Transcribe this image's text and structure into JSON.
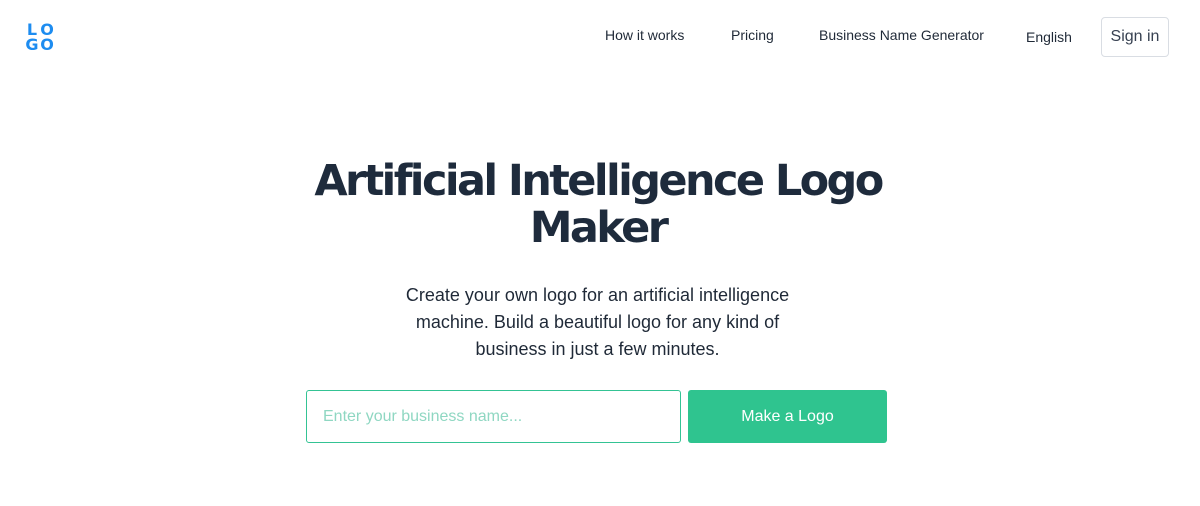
{
  "brand": {
    "logo_letters": [
      "L",
      "O",
      "G",
      "O"
    ],
    "color": "#1d8cf0"
  },
  "nav": {
    "how_it_works": "How it works",
    "pricing": "Pricing",
    "business_name_generator": "Business Name Generator",
    "language": "English",
    "sign_in": "Sign in"
  },
  "hero": {
    "title_line1": "Artificial Intelligence Logo",
    "title_line2": "Maker",
    "subtitle_line1": "Create your own logo for an artificial intelligence",
    "subtitle_line2": "machine. Build a beautiful logo for any kind of",
    "subtitle_line3": "business in just a few minutes.",
    "input_placeholder": "Enter your business name...",
    "input_value": "",
    "cta_label": "Make a Logo",
    "accent_color": "#2fc48f"
  }
}
